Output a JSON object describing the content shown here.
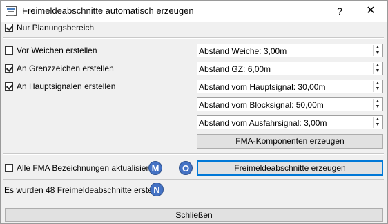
{
  "window": {
    "title": "Freimeldeabschnitte automatisch erzeugen",
    "help_label": "?",
    "close_label": "✕"
  },
  "options": {
    "nur_planungsbereich": {
      "label": "Nur Planungsbereich",
      "checked": true
    },
    "vor_weichen": {
      "label": "Vor Weichen erstellen",
      "checked": false
    },
    "an_grenzzeichen": {
      "label": "An Grenzzeichen erstellen",
      "checked": true
    },
    "an_hauptsignalen": {
      "label": "An Hauptsignalen erstellen",
      "checked": true
    },
    "alle_fma": {
      "label": "Alle FMA Bezeichnungen aktualisieren",
      "checked": false
    }
  },
  "fields": [
    {
      "value": "Abstand Weiche: 3,00m"
    },
    {
      "value": "Abstand GZ: 6,00m"
    },
    {
      "value": "Abstand vom Hauptsignal: 30,00m"
    },
    {
      "value": "Abstand vom Blocksignal: 50,00m"
    },
    {
      "value": "Abstand vom Ausfahrsignal: 3,00m"
    }
  ],
  "buttons": {
    "fma_komponenten": "FMA-Komponenten erzeugen",
    "freimeldeabschnitte": "Freimeldeabschnitte erzeugen",
    "schliessen": "Schließen"
  },
  "markers": {
    "m": "M",
    "o": "O",
    "n": "N"
  },
  "status": "Es wurden 48 Freimeldeabschnitte erstellt",
  "colors": {
    "marker_fill": "#4472c4",
    "primary_border": "#0078d7"
  }
}
